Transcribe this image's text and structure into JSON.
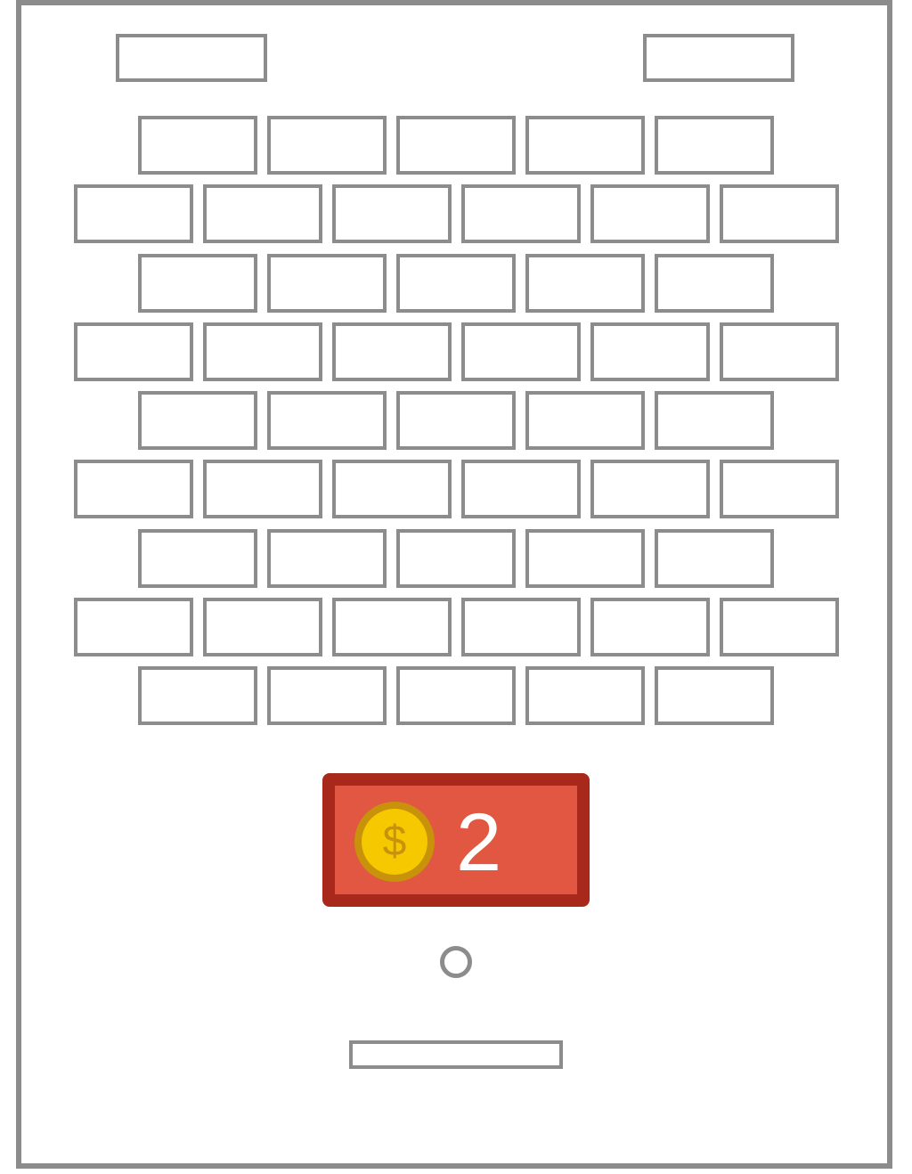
{
  "game": {
    "coins": "2",
    "coin_symbol": "$",
    "brick_rows": [
      5,
      6,
      5,
      6,
      5,
      6,
      5,
      6,
      5
    ]
  },
  "colors": {
    "outline": "#8c8c8c",
    "panel_fill": "#e15741",
    "panel_border": "#a8291b",
    "coin_gold": "#f5c800",
    "coin_rim": "#c8920a"
  },
  "icons": {
    "coin": "dollar-coin-icon"
  }
}
